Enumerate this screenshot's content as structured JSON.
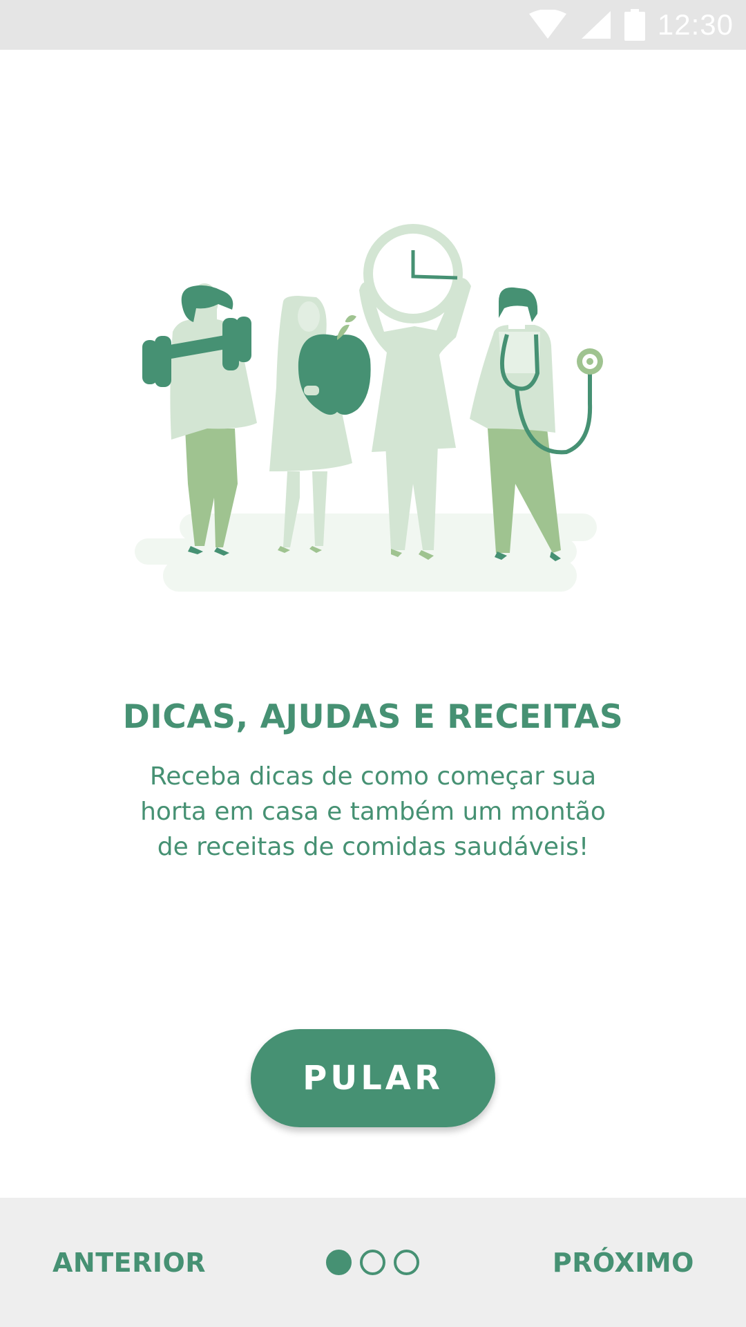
{
  "status_bar": {
    "time": "12:30",
    "icons": [
      "wifi-icon",
      "signal-icon",
      "battery-icon"
    ]
  },
  "onboarding": {
    "illustration": "people-health-illustration",
    "title": "DICAS, AJUDAS E RECEITAS",
    "description": "Receba dicas de como começar sua horta em casa e também um montão de receitas de comidas saudáveis!",
    "skip_label": "PULAR"
  },
  "navigation": {
    "prev_label": "ANTERIOR",
    "next_label": "PRÓXIMO",
    "page_indicator": {
      "count": 3,
      "current": 1
    }
  },
  "colors": {
    "primary": "#469173",
    "light_green": "#d3e5d3",
    "mid_green": "#9fc390",
    "ground": "#f1f7f1",
    "status_bar": "#e5e5e5",
    "bottom_bar": "#eeeeee"
  }
}
